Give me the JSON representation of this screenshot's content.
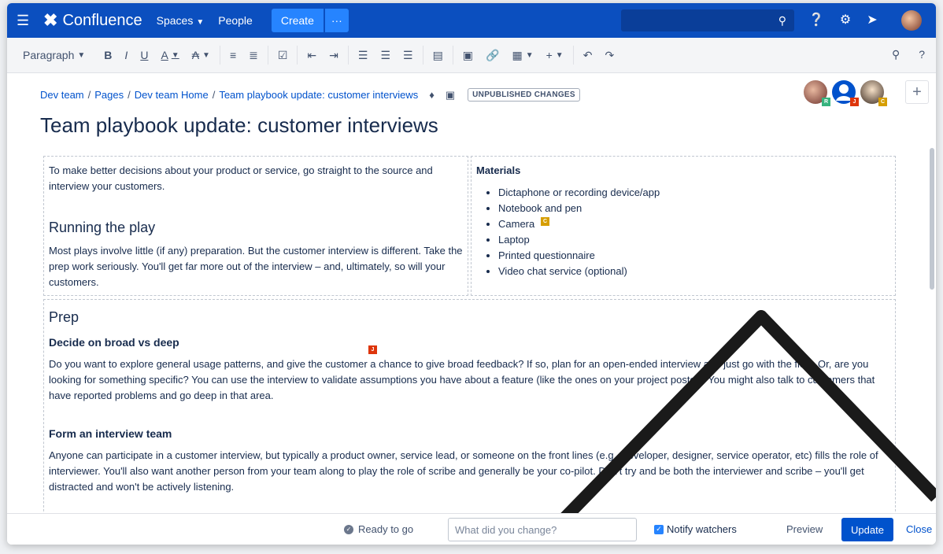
{
  "topnav": {
    "app_name": "Confluence",
    "spaces": "Spaces",
    "people": "People",
    "create": "Create",
    "more": "···"
  },
  "toolbar": {
    "paragraph": "Paragraph",
    "bold": "B",
    "italic": "I",
    "underline": "U",
    "color": "A"
  },
  "breadcrumb": [
    "Dev team",
    "Pages",
    "Dev team Home",
    "Team playbook update: customer interviews"
  ],
  "badge": "UNPUBLISHED CHANGES",
  "collaborators": [
    {
      "initial": "R",
      "color": "#36b37e"
    },
    {
      "initial": "J",
      "color": "#de350b"
    },
    {
      "initial": "C",
      "color": "#d69e00"
    }
  ],
  "page": {
    "title": "Team playbook update: customer interviews",
    "intro": "To make better decisions about your product or service, go straight to the source and interview your customers.",
    "running_heading": "Running the play",
    "running_text": "Most plays involve little (if any) preparation. But the customer interview is different. Take the prep work seriously. You'll get far more out of the interview – and, ultimately, so will your customers.",
    "materials_title": "Materials",
    "materials": [
      "Dictaphone or recording device/app",
      "Notebook and pen",
      "Camera",
      "Laptop",
      "Printed questionnaire",
      "Video chat service (optional)"
    ],
    "prep_heading": "Prep",
    "broad_heading": "Decide on broad vs deep",
    "broad_text": "Do you want to explore general usage patterns, and give the customer a chance to give broad feedback? If so, plan for an open-ended interview and just go with the flow. Or, are you looking for something specific? You can use the interview to validate assumptions you have about a feature (like the ones on your project poster). You might also talk to customers that have reported problems and go deep in that area.",
    "team_heading": "Form an interview team",
    "team_text": "Anyone can participate in a customer interview, but typically a product owner, service lead, or someone on the front lines (e.g., developer, designer, service operator, etc) fills the role of interviewer. You'll also want another person from your team along to play the role of scribe and generally be your co-pilot. Don't try and be both the interviewer and scribe – you'll get distracted and won't be actively listening."
  },
  "cursors": {
    "c_label": "C",
    "j_label": "J"
  },
  "footer": {
    "ready": "Ready to go",
    "change_placeholder": "What did you change?",
    "notify": "Notify watchers",
    "preview": "Preview",
    "update": "Update",
    "close": "Close"
  }
}
